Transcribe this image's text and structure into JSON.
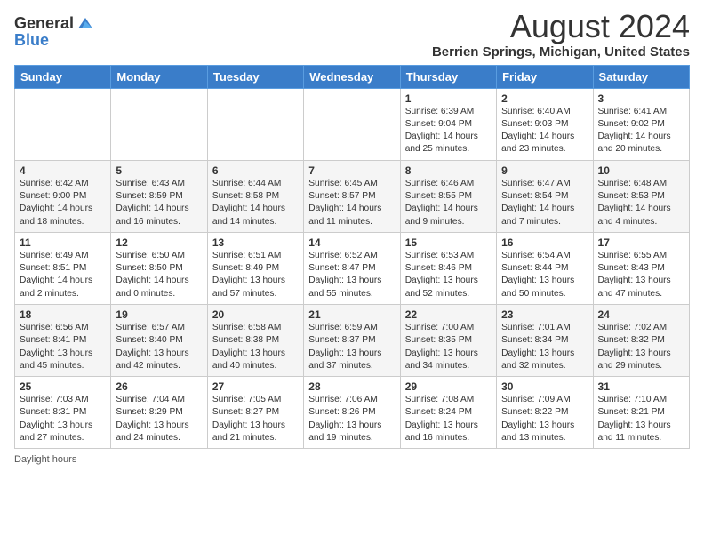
{
  "header": {
    "logo_general": "General",
    "logo_blue": "Blue",
    "month_title": "August 2024",
    "location": "Berrien Springs, Michigan, United States"
  },
  "days_of_week": [
    "Sunday",
    "Monday",
    "Tuesday",
    "Wednesday",
    "Thursday",
    "Friday",
    "Saturday"
  ],
  "weeks": [
    [
      {
        "day": "",
        "info": ""
      },
      {
        "day": "",
        "info": ""
      },
      {
        "day": "",
        "info": ""
      },
      {
        "day": "",
        "info": ""
      },
      {
        "day": "1",
        "info": "Sunrise: 6:39 AM\nSunset: 9:04 PM\nDaylight: 14 hours and 25 minutes."
      },
      {
        "day": "2",
        "info": "Sunrise: 6:40 AM\nSunset: 9:03 PM\nDaylight: 14 hours and 23 minutes."
      },
      {
        "day": "3",
        "info": "Sunrise: 6:41 AM\nSunset: 9:02 PM\nDaylight: 14 hours and 20 minutes."
      }
    ],
    [
      {
        "day": "4",
        "info": "Sunrise: 6:42 AM\nSunset: 9:00 PM\nDaylight: 14 hours and 18 minutes."
      },
      {
        "day": "5",
        "info": "Sunrise: 6:43 AM\nSunset: 8:59 PM\nDaylight: 14 hours and 16 minutes."
      },
      {
        "day": "6",
        "info": "Sunrise: 6:44 AM\nSunset: 8:58 PM\nDaylight: 14 hours and 14 minutes."
      },
      {
        "day": "7",
        "info": "Sunrise: 6:45 AM\nSunset: 8:57 PM\nDaylight: 14 hours and 11 minutes."
      },
      {
        "day": "8",
        "info": "Sunrise: 6:46 AM\nSunset: 8:55 PM\nDaylight: 14 hours and 9 minutes."
      },
      {
        "day": "9",
        "info": "Sunrise: 6:47 AM\nSunset: 8:54 PM\nDaylight: 14 hours and 7 minutes."
      },
      {
        "day": "10",
        "info": "Sunrise: 6:48 AM\nSunset: 8:53 PM\nDaylight: 14 hours and 4 minutes."
      }
    ],
    [
      {
        "day": "11",
        "info": "Sunrise: 6:49 AM\nSunset: 8:51 PM\nDaylight: 14 hours and 2 minutes."
      },
      {
        "day": "12",
        "info": "Sunrise: 6:50 AM\nSunset: 8:50 PM\nDaylight: 14 hours and 0 minutes."
      },
      {
        "day": "13",
        "info": "Sunrise: 6:51 AM\nSunset: 8:49 PM\nDaylight: 13 hours and 57 minutes."
      },
      {
        "day": "14",
        "info": "Sunrise: 6:52 AM\nSunset: 8:47 PM\nDaylight: 13 hours and 55 minutes."
      },
      {
        "day": "15",
        "info": "Sunrise: 6:53 AM\nSunset: 8:46 PM\nDaylight: 13 hours and 52 minutes."
      },
      {
        "day": "16",
        "info": "Sunrise: 6:54 AM\nSunset: 8:44 PM\nDaylight: 13 hours and 50 minutes."
      },
      {
        "day": "17",
        "info": "Sunrise: 6:55 AM\nSunset: 8:43 PM\nDaylight: 13 hours and 47 minutes."
      }
    ],
    [
      {
        "day": "18",
        "info": "Sunrise: 6:56 AM\nSunset: 8:41 PM\nDaylight: 13 hours and 45 minutes."
      },
      {
        "day": "19",
        "info": "Sunrise: 6:57 AM\nSunset: 8:40 PM\nDaylight: 13 hours and 42 minutes."
      },
      {
        "day": "20",
        "info": "Sunrise: 6:58 AM\nSunset: 8:38 PM\nDaylight: 13 hours and 40 minutes."
      },
      {
        "day": "21",
        "info": "Sunrise: 6:59 AM\nSunset: 8:37 PM\nDaylight: 13 hours and 37 minutes."
      },
      {
        "day": "22",
        "info": "Sunrise: 7:00 AM\nSunset: 8:35 PM\nDaylight: 13 hours and 34 minutes."
      },
      {
        "day": "23",
        "info": "Sunrise: 7:01 AM\nSunset: 8:34 PM\nDaylight: 13 hours and 32 minutes."
      },
      {
        "day": "24",
        "info": "Sunrise: 7:02 AM\nSunset: 8:32 PM\nDaylight: 13 hours and 29 minutes."
      }
    ],
    [
      {
        "day": "25",
        "info": "Sunrise: 7:03 AM\nSunset: 8:31 PM\nDaylight: 13 hours and 27 minutes."
      },
      {
        "day": "26",
        "info": "Sunrise: 7:04 AM\nSunset: 8:29 PM\nDaylight: 13 hours and 24 minutes."
      },
      {
        "day": "27",
        "info": "Sunrise: 7:05 AM\nSunset: 8:27 PM\nDaylight: 13 hours and 21 minutes."
      },
      {
        "day": "28",
        "info": "Sunrise: 7:06 AM\nSunset: 8:26 PM\nDaylight: 13 hours and 19 minutes."
      },
      {
        "day": "29",
        "info": "Sunrise: 7:08 AM\nSunset: 8:24 PM\nDaylight: 13 hours and 16 minutes."
      },
      {
        "day": "30",
        "info": "Sunrise: 7:09 AM\nSunset: 8:22 PM\nDaylight: 13 hours and 13 minutes."
      },
      {
        "day": "31",
        "info": "Sunrise: 7:10 AM\nSunset: 8:21 PM\nDaylight: 13 hours and 11 minutes."
      }
    ]
  ],
  "footer": {
    "daylight_label": "Daylight hours"
  }
}
